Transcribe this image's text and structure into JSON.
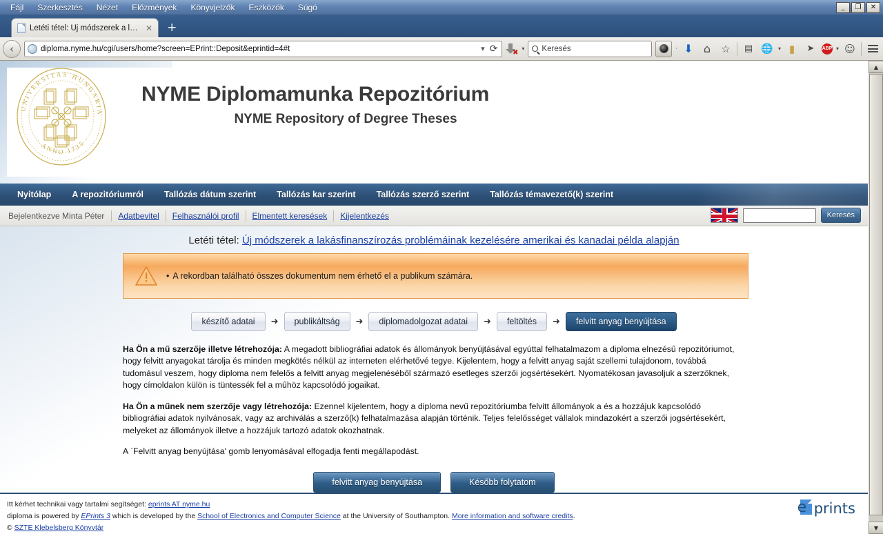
{
  "browser": {
    "menus": [
      "Fájl",
      "Szerkesztés",
      "Nézet",
      "Előzmények",
      "Könyvjelzők",
      "Eszközök",
      "Súgó"
    ],
    "window_buttons": {
      "minimize": "_",
      "maximize": "❐",
      "close": "✕"
    },
    "tab": {
      "title": "Letéti tétel: Új módszerek a la...",
      "close_label": "✕",
      "new_tab_label": "+"
    },
    "url": "diploma.nyme.hu/cgi/users/home?screen=EPrint::Deposit&eprintid=4#t",
    "back_label": "‹",
    "reload_label": "⟳",
    "url_dropdown_label": "▾",
    "search": {
      "placeholder": "Keresés"
    },
    "toolbar_icons": [
      "download-icon",
      "dropdown-caret",
      "screenshot-button",
      "caret",
      "download-arrow-icon",
      "home-icon",
      "bookmark-star-icon",
      "reader-list-icon",
      "translate-globe-icon",
      "caret",
      "book-icon",
      "send-paper-plane-icon",
      "adblock-plus-icon",
      "caret",
      "smiley-icon",
      "menu-hamburger-icon"
    ],
    "abp_label": "ABP",
    "home_glyph": "⌂",
    "star_glyph": "☆",
    "clipboard_glyph": "▤",
    "book_glyph": "▮",
    "plane_glyph": "➤",
    "smiley_glyph": "☺",
    "down_arrow_glyph": "⬇"
  },
  "site": {
    "title": "NYME Diplomamunka Repozitórium",
    "subtitle": "NYME Repository of Degree Theses",
    "logo_alt": "UNIVERSITAS HUNGARIAE OCCIDENTALIS · ANNO 1735 ·",
    "nav": [
      "Nyitólap",
      "A repozitóriumról",
      "Tallózás dátum szerint",
      "Tallózás kar szerint",
      "Tallózás szerző szerint",
      "Tallózás témavezető(k) szerint"
    ],
    "userbar": {
      "logged_in_text": "Bejelentkezve Minta Péter",
      "links": [
        "Adatbevitel",
        "Felhasználói profil",
        "Elmentett keresések",
        "Kijelentkezés"
      ],
      "search_value": "",
      "search_button": "Keresés",
      "flag": "uk-flag-icon"
    }
  },
  "page": {
    "heading_label": "Letéti tétel:",
    "heading_title": "Új módszerek a lakásfinanszírozás problémáinak kezelésére amerikai és kanadai példa alapján",
    "warning": {
      "icon": "warning-triangle-icon",
      "bullet": "•",
      "text": "A rekordban található összes dokumentum nem érhető el a publikum számára."
    },
    "steps": [
      {
        "label": "készítő adatai",
        "current": false
      },
      {
        "label": "publikáltság",
        "current": false
      },
      {
        "label": "diplomadolgozat adatai",
        "current": false
      },
      {
        "label": "feltöltés",
        "current": false
      },
      {
        "label": "felvitt anyag benyújtása",
        "current": true
      }
    ],
    "step_arrow": "➜",
    "agreement": {
      "p1_bold": "Ha Ön a mű szerzője illetve létrehozója:",
      "p1_text": " A megadott bibliográfiai adatok és állományok benyújtásával egyúttal felhatalmazom a diploma elnezésű repozitóriumot, hogy felvitt anyagokat tárolja és minden megkötés nélkül az interneten elérhetővé tegye. Kijelentem, hogy a felvitt anyag saját szellemi tulajdonom, továbbá tudomásul veszem, hogy diploma nem felelős a felvitt anyag megjelenéséből származó esetleges szerzői jogsértésekért. Nyomatékosan javasoljuk a szerzőknek, hogy címoldalon külön is tüntessék fel a műhöz kapcsolódó jogaikat.",
      "p2_bold": "Ha Ön a műnek nem szerzője vagy létrehozója:",
      "p2_text": " Ezennel kijelentem, hogy a diploma nevű repozitóriumba felvitt állományok a és a hozzájuk kapcsolódó bibliográfiai adatok nyilvánosak, vagy az archiválás a szerző(k) felhatalmazása alapján történik. Teljes felelősséget vállalok mindazokért a szerzői jogsértésekért, melyeket az állományok illetve a hozzájuk tartozó adatok okozhatnak.",
      "p3_text": "A `Felvitt anyag benyújtása' gomb lenyomásával elfogadja fenti megállapodást."
    },
    "actions": [
      {
        "label": "felvitt anyag benyújtása"
      },
      {
        "label": "Később folytatom"
      }
    ]
  },
  "footer": {
    "line1_prefix": "Itt kérhet technikai vagy tartalmi segítséget: ",
    "line1_link": "eprints AT nyme.hu",
    "line2_a": "diploma is powered by ",
    "line2_link1": "EPrints 3",
    "line2_b": " which is developed by the ",
    "line2_link2": "School of Electronics and Computer Science",
    "line2_c": " at the University of Southampton. ",
    "line2_link3": "More information and software credits",
    "line2_d": ".",
    "line3_prefix": "© ",
    "line3_link": "SZTE Klebelsberg Könyvtár",
    "logo_e": "e",
    "logo_word": "prints"
  },
  "scrollbar": {
    "up": "▲",
    "down": "▼"
  },
  "colors": {
    "nav_blue": "#2d5077",
    "accent_link": "#1a3fa5",
    "warning_orange": "#f6a95e",
    "logo_gold": "#c9ae4e"
  }
}
